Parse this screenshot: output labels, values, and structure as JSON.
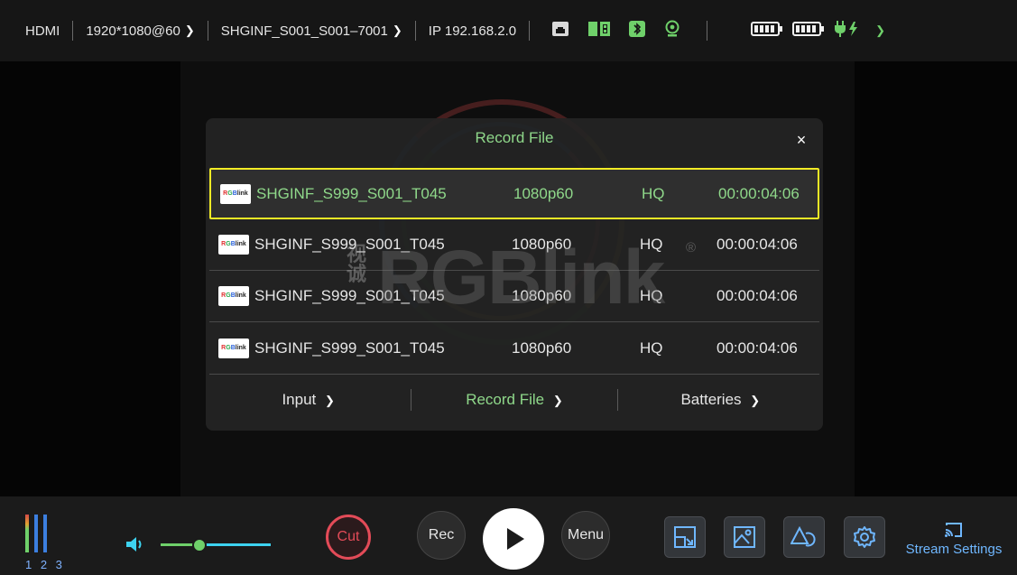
{
  "topbar": {
    "source": "HDMI",
    "resolution": "1920*1080@60",
    "filename": "SHGINF_S001_S001–7001",
    "ip": "IP 192.168.2.0",
    "icons": [
      "ethernet-icon",
      "sd-card-icon",
      "bluetooth-icon",
      "webcam-icon",
      "battery-icon",
      "battery-icon",
      "power-plug-icon"
    ]
  },
  "watermark": {
    "brand": "RGBlink",
    "cn_chars": "视诚",
    "registered": "®"
  },
  "dialog": {
    "title": "Record File",
    "close": "×",
    "rows": [
      {
        "name": "SHGINF_S999_S001_T045",
        "resolution": "1080p60",
        "quality": "HQ",
        "duration": "00:00:04:06",
        "thumb": "RGBlink",
        "selected": true
      },
      {
        "name": "SHGINF_S999_S001_T045",
        "resolution": "1080p60",
        "quality": "HQ",
        "duration": "00:00:04:06",
        "thumb": "RGBlink",
        "selected": false
      },
      {
        "name": "SHGINF_S999_S001_T045",
        "resolution": "1080p60",
        "quality": "HQ",
        "duration": "00:00:04:06",
        "thumb": "RGBlink",
        "selected": false
      },
      {
        "name": "SHGINF_S999_S001_T045",
        "resolution": "1080p60",
        "quality": "HQ",
        "duration": "00:00:04:06",
        "thumb": "RGBlink",
        "selected": false
      }
    ],
    "tabs": [
      {
        "label": "Input",
        "active": false
      },
      {
        "label": "Record File",
        "active": true
      },
      {
        "label": "Batteries",
        "active": false
      }
    ]
  },
  "bottombar": {
    "meter_labels": "1 2 3",
    "volume_level": 0.35,
    "cut_label": "Cut",
    "rec_label": "Rec",
    "menu_label": "Menu",
    "stream_label": "Stream Settings"
  },
  "colors": {
    "accent_green": "#8fd88a",
    "selection_yellow": "#f2ec25",
    "cut_red": "#e34b58",
    "stream_blue": "#6fb7ff"
  }
}
